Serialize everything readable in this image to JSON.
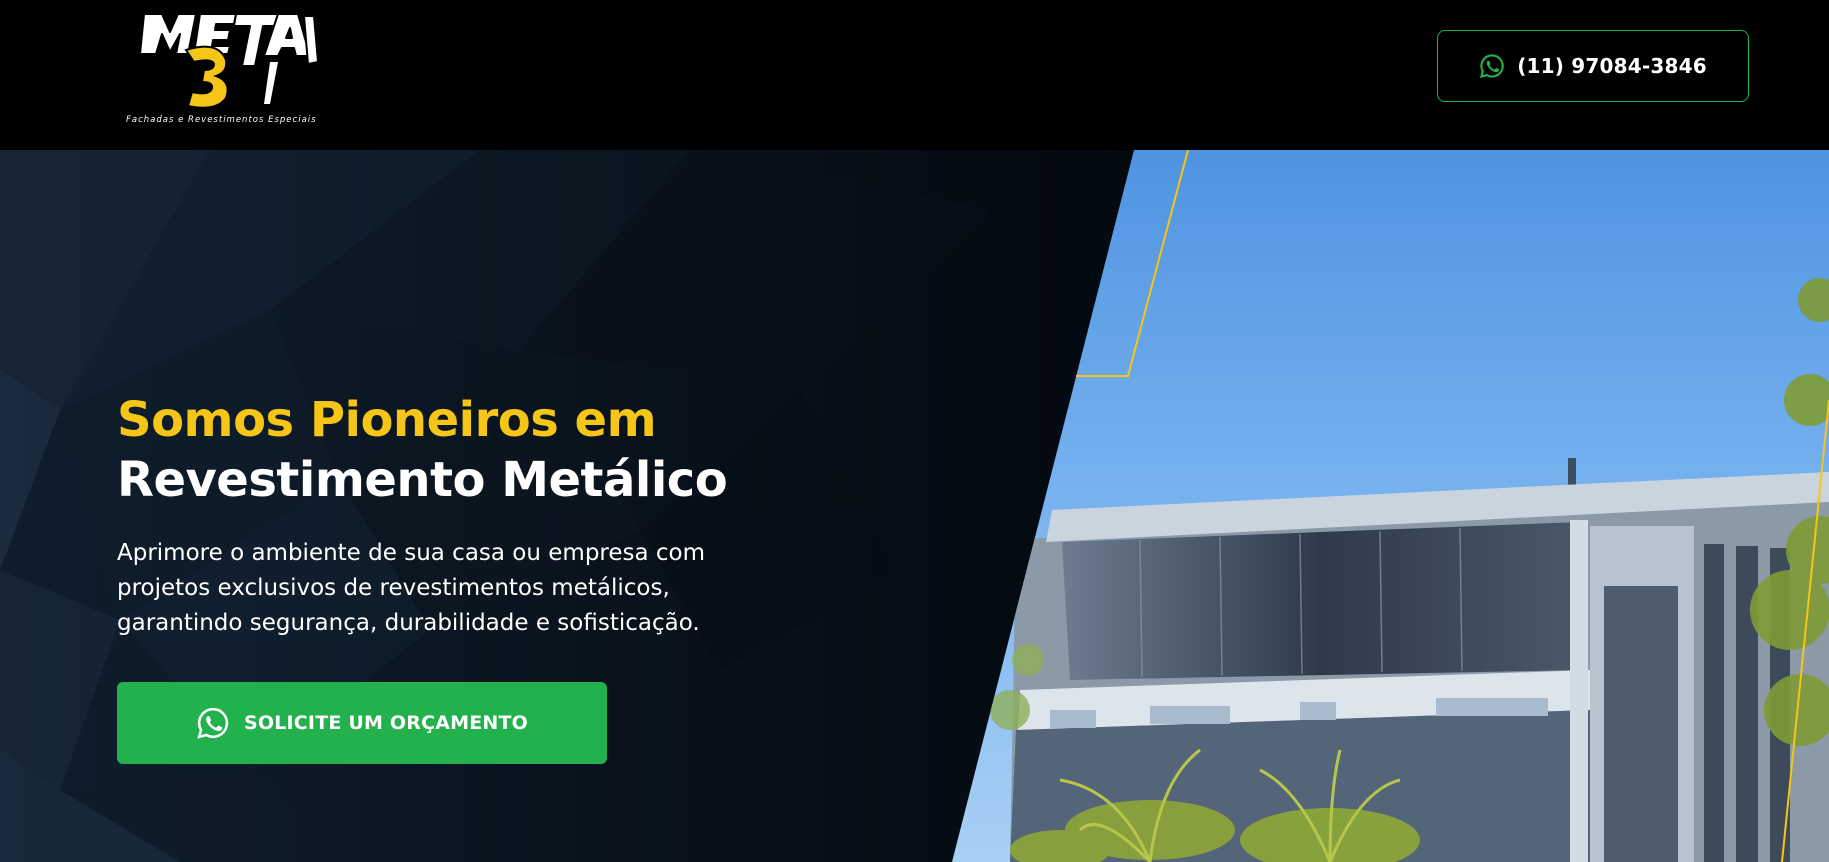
{
  "header": {
    "logo": {
      "wordmark": "META 3",
      "tagline": "Fachadas e Revestimentos Especiais",
      "number": "3"
    },
    "phone": {
      "icon": "whatsapp-icon",
      "label": "(11) 97084-3846"
    }
  },
  "hero": {
    "title_line_1": "Somos Pioneiros em",
    "title_line_2": "Revestimento Metálico",
    "description": "Aprimore o ambiente de sua casa ou empresa com projetos exclusivos de revestimentos metálicos, garantindo segurança, durabilidade e sofisticação.",
    "cta": {
      "icon": "whatsapp-icon",
      "label": "SOLICITE UM ORÇAMENTO"
    },
    "image": "building-facade-photo"
  },
  "colors": {
    "accent_yellow": "#f5c518",
    "whatsapp_green": "#22b14c",
    "background": "#000000",
    "hero_dark": "#03080f"
  }
}
